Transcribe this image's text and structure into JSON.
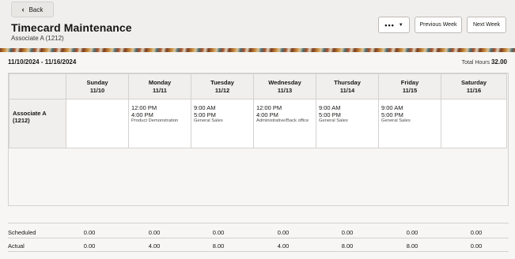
{
  "header": {
    "back_label": "Back",
    "title": "Timecard Maintenance",
    "subtitle": "Associate A (1212)",
    "more_label": "•••",
    "prev_week_label": "Previous Week",
    "next_week_label": "Next Week"
  },
  "range": {
    "date_range": "11/10/2024 - 11/16/2024",
    "total_label": "Total Hours",
    "total_value": "32.00"
  },
  "days": [
    {
      "name": "Sunday",
      "date": "11/10"
    },
    {
      "name": "Monday",
      "date": "11/11"
    },
    {
      "name": "Tuesday",
      "date": "11/12"
    },
    {
      "name": "Wednesday",
      "date": "11/13"
    },
    {
      "name": "Thursday",
      "date": "11/14"
    },
    {
      "name": "Friday",
      "date": "11/15"
    },
    {
      "name": "Saturday",
      "date": "11/16"
    }
  ],
  "employee": {
    "name": "Associate A",
    "id": "(1212)"
  },
  "shifts": [
    {
      "start": "",
      "end": "",
      "dept": ""
    },
    {
      "start": "12:00 PM",
      "end": "4:00 PM",
      "dept": "Product Demonstration"
    },
    {
      "start": "9:00 AM",
      "end": "5:00 PM",
      "dept": "General Sales"
    },
    {
      "start": "12:00 PM",
      "end": "4:00 PM",
      "dept": "Administrative/Back office"
    },
    {
      "start": "9:00 AM",
      "end": "5:00 PM",
      "dept": "General Sales"
    },
    {
      "start": "9:00 AM",
      "end": "5:00 PM",
      "dept": "General Sales"
    },
    {
      "start": "",
      "end": "",
      "dept": ""
    }
  ],
  "summary": {
    "scheduled_label": "Scheduled",
    "scheduled": [
      "0.00",
      "0.00",
      "0.00",
      "0.00",
      "0.00",
      "0.00",
      "0.00"
    ],
    "actual_label": "Actual",
    "actual": [
      "0.00",
      "4.00",
      "8.00",
      "4.00",
      "8.00",
      "8.00",
      "0.00"
    ]
  }
}
